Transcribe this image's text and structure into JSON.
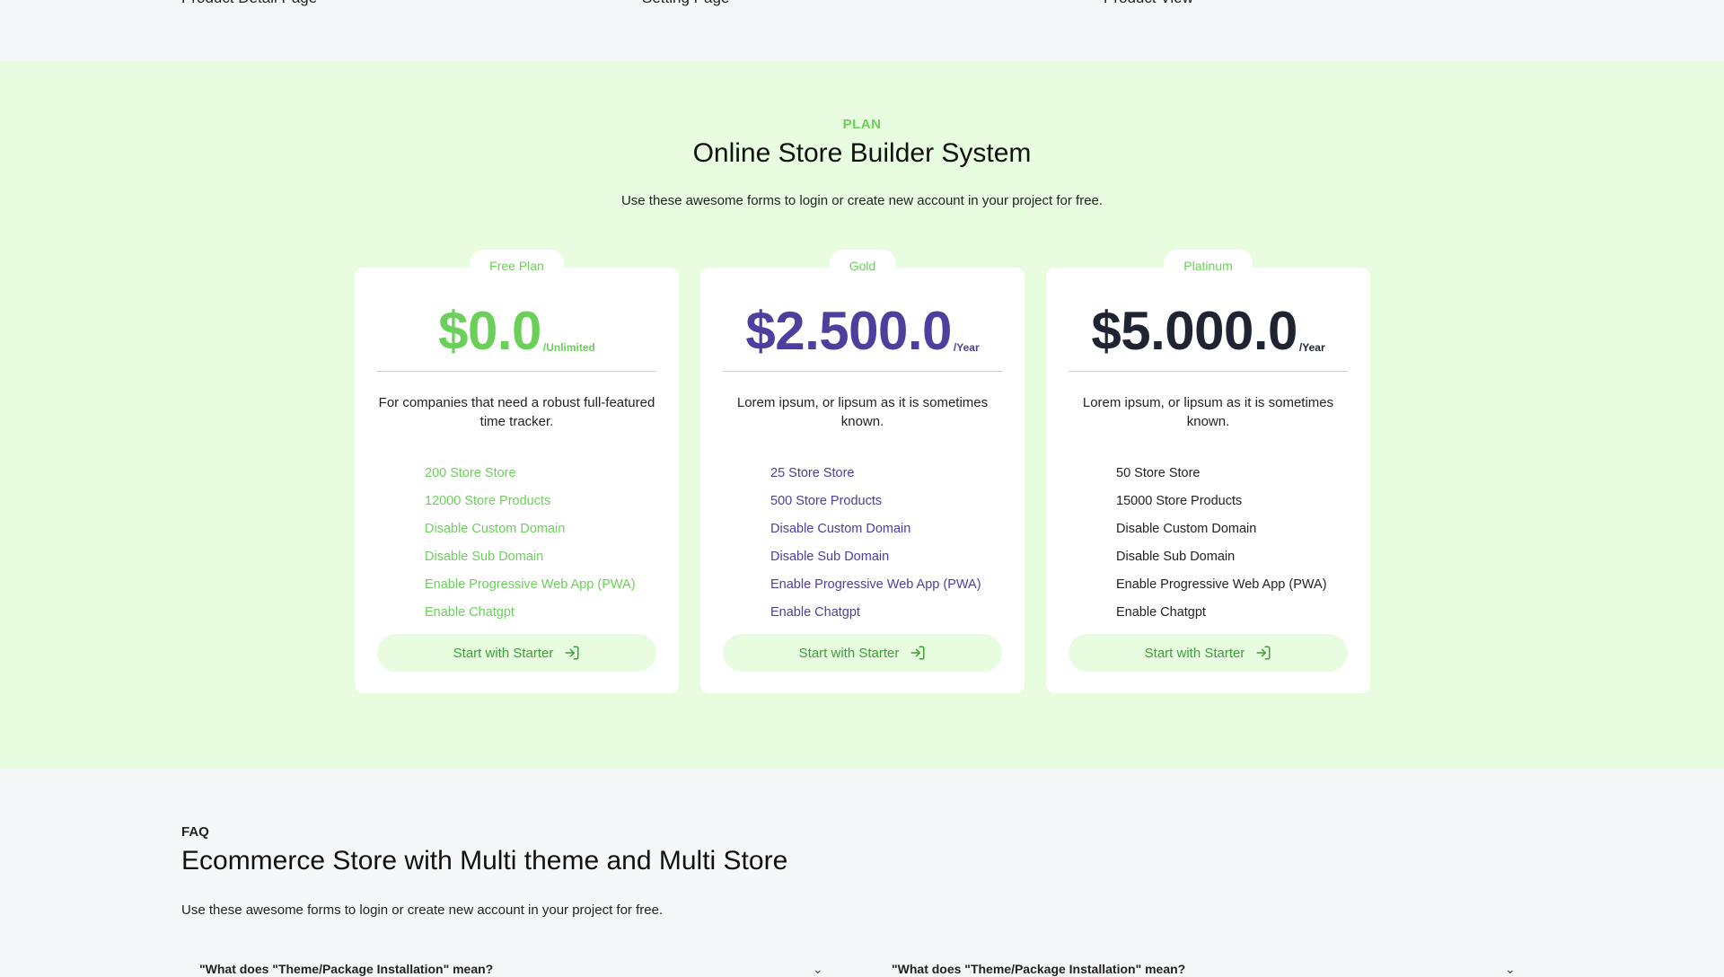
{
  "top_strip": {
    "labels": [
      "Product Detail Page",
      "Setting Page",
      "Product View"
    ]
  },
  "plan_section": {
    "kicker": "PLAN",
    "title": "Online Store Builder System",
    "subtitle": "Use these awesome forms to login or create new account in your project for free.",
    "cards": [
      {
        "tab": "Free Plan",
        "price": "$0.0",
        "period": "/Unlimited",
        "accent_color": "#6bd05a",
        "description": "For companies that need a robust full-featured time tracker.",
        "features": [
          "200 Store Store",
          "12000 Store Products",
          "Disable Custom Domain",
          "Disable Sub Domain",
          "Enable Progressive Web App (PWA)",
          "Enable Chatgpt"
        ],
        "button": "Start with Starter",
        "button_icon": "sign-in-icon"
      },
      {
        "tab": "Gold",
        "price": "$2.500.0",
        "period": "/Year",
        "accent_color": "#4d3f9e",
        "description": "Lorem ipsum, or lipsum as it is sometimes known.",
        "features": [
          "25 Store Store",
          "500 Store Products",
          "Disable Custom Domain",
          "Disable Sub Domain",
          "Enable Progressive Web App (PWA)",
          "Enable Chatgpt"
        ],
        "button": "Start with Starter",
        "button_icon": "sign-in-icon"
      },
      {
        "tab": "Platinum",
        "price": "$5.000.0",
        "period": "/Year",
        "accent_color": "#1e2431",
        "description": "Lorem ipsum, or lipsum as it is sometimes known.",
        "features": [
          "50 Store Store",
          "15000 Store Products",
          "Disable Custom Domain",
          "Disable Sub Domain",
          "Enable Progressive Web App (PWA)",
          "Enable Chatgpt"
        ],
        "button": "Start with Starter",
        "button_icon": "sign-in-icon"
      }
    ]
  },
  "faq": {
    "kicker": "FAQ",
    "title": "Ecommerce Store with Multi theme and Multi Store",
    "subtitle": "Use these awesome forms to login or create new account in your project for free.",
    "questions": [
      "\"What does \"Theme/Package Installation\" mean?",
      "\"What does \"Theme/Package Installation\" mean?"
    ]
  }
}
